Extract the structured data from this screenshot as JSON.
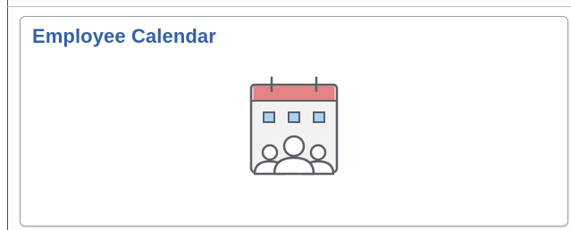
{
  "tile": {
    "title": "Employee Calendar",
    "icon": "employee-calendar-icon"
  },
  "colors": {
    "title": "#3561a2",
    "calendar_header": "#e48385",
    "calendar_cells": "#a6d3f2",
    "outline": "#5b5f66"
  }
}
